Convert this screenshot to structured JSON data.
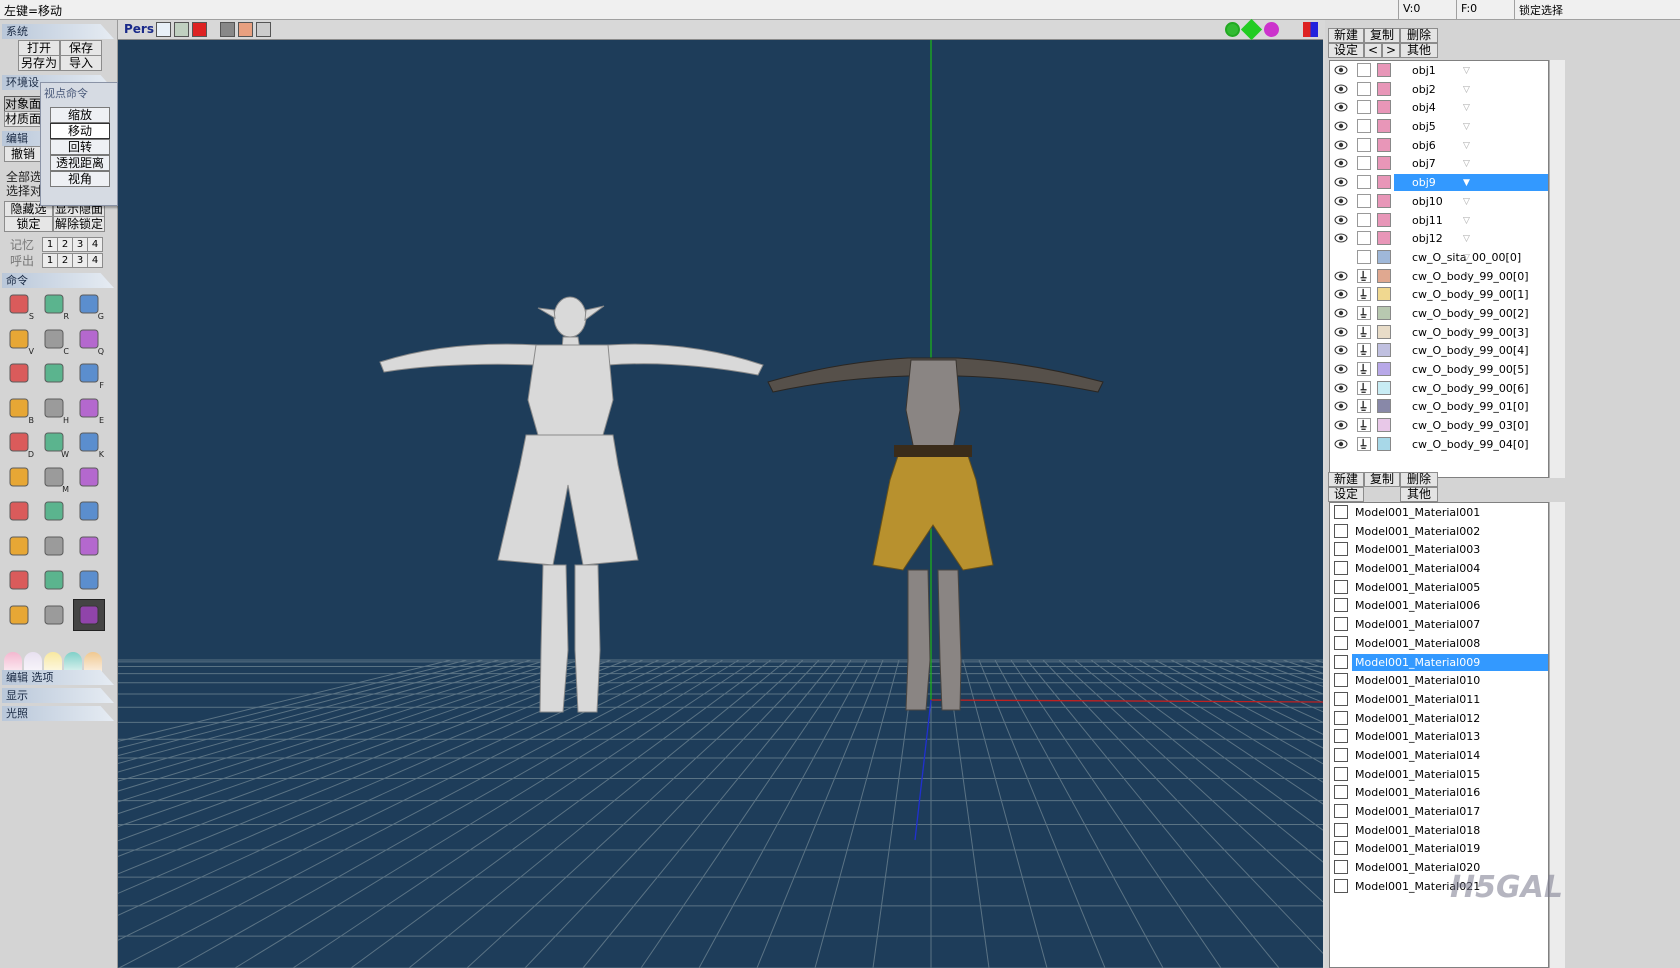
{
  "status": {
    "message": "左键=移动",
    "v": "V:0",
    "f": "F:0",
    "mode": "锁定选择"
  },
  "left": {
    "sections": {
      "system": "系统",
      "env": "环境设",
      "edit": "编辑",
      "command": "命令",
      "edit_options": "编辑 选项",
      "display": "显示",
      "light": "光照"
    },
    "file": {
      "open": "打开",
      "save": "保存",
      "save_as": "另存为",
      "import": "导入"
    },
    "side_buttons": {
      "object": "对象面",
      "material": "材质面",
      "undo": "撤销",
      "select_all": "全部选",
      "select_obj": "选择对"
    },
    "hide_show": {
      "hide": "隐藏选面",
      "show": "显示隐面",
      "lock": "锁定",
      "unlock": "解除锁定"
    },
    "memory": {
      "label": "记忆",
      "recall": "呼出",
      "slots": [
        "1",
        "2",
        "3",
        "4"
      ]
    },
    "popup": {
      "title": "视点命令",
      "items": [
        "缩放",
        "移动",
        "回转",
        "透视距离",
        "视角"
      ],
      "active": "移动"
    },
    "tool_icons": [
      "select-arrow-icon",
      "rect-select-icon",
      "lasso-select-icon",
      "move-icon",
      "rotate-icon",
      "scale-icon",
      "vertex-edit-icon",
      "box-icon",
      "plane-icon",
      "magnet-icon",
      "grid-split-icon",
      "extrude-icon",
      "bucket-icon",
      "knife-icon",
      "slice-icon",
      "axis-rotate-icon",
      "wand-icon",
      "angle-icon",
      "lattice-icon",
      "bend-icon",
      "bevel-icon",
      "cylinder-icon",
      "uv-cylinder-icon",
      "paint-palette-icon",
      "box-move-icon",
      "mirror-icon",
      "vertex-box-icon",
      "join-icon",
      "document-icon",
      "render-icon"
    ],
    "shortcut_keys": [
      "S",
      "R",
      "G",
      "V",
      "C",
      "Q",
      "",
      "",
      "F",
      "B",
      "H",
      "E",
      "D",
      "W",
      "K",
      "",
      "M",
      "",
      "",
      "",
      "",
      "",
      "",
      "",
      "",
      "",
      "",
      "",
      "",
      ""
    ]
  },
  "viewport": {
    "mode_label": "Pers"
  },
  "objects": {
    "buttons": {
      "new": "新建",
      "copy": "复制",
      "delete": "删除",
      "settings": "设定",
      "prev": "<",
      "next": ">",
      "other": "其他"
    },
    "items": [
      {
        "name": "obj1",
        "color": "#e896b8",
        "visible": true,
        "locked": false
      },
      {
        "name": "obj2",
        "color": "#e896b8",
        "visible": true,
        "locked": false
      },
      {
        "name": "obj4",
        "color": "#e896b8",
        "visible": true,
        "locked": false
      },
      {
        "name": "obj5",
        "color": "#e896b8",
        "visible": true,
        "locked": false
      },
      {
        "name": "obj6",
        "color": "#e896b8",
        "visible": true,
        "locked": false
      },
      {
        "name": "obj7",
        "color": "#e896b8",
        "visible": true,
        "locked": false
      },
      {
        "name": "obj9",
        "color": "#e896b8",
        "visible": true,
        "locked": false,
        "selected": true
      },
      {
        "name": "obj10",
        "color": "#e896b8",
        "visible": true,
        "locked": false
      },
      {
        "name": "obj11",
        "color": "#e896b8",
        "visible": true,
        "locked": false
      },
      {
        "name": "obj12",
        "color": "#e896b8",
        "visible": true,
        "locked": false
      },
      {
        "name": "cw_O_sita_00_00[0]",
        "color": "#9fb8d9",
        "visible": false,
        "locked": false
      },
      {
        "name": "cw_O_body_99_00[0]",
        "color": "#e0a890",
        "visible": true,
        "locked": true
      },
      {
        "name": "cw_O_body_99_00[1]",
        "color": "#f0d890",
        "visible": true,
        "locked": true
      },
      {
        "name": "cw_O_body_99_00[2]",
        "color": "#b8c8b0",
        "visible": true,
        "locked": true
      },
      {
        "name": "cw_O_body_99_00[3]",
        "color": "#e8dcc8",
        "visible": true,
        "locked": true
      },
      {
        "name": "cw_O_body_99_00[4]",
        "color": "#c0c0e0",
        "visible": true,
        "locked": true
      },
      {
        "name": "cw_O_body_99_00[5]",
        "color": "#b8a8e8",
        "visible": true,
        "locked": true
      },
      {
        "name": "cw_O_body_99_00[6]",
        "color": "#c8ecf4",
        "visible": true,
        "locked": true
      },
      {
        "name": "cw_O_body_99_01[0]",
        "color": "#8888a8",
        "visible": true,
        "locked": true
      },
      {
        "name": "cw_O_body_99_03[0]",
        "color": "#e8c8e8",
        "visible": true,
        "locked": true
      },
      {
        "name": "cw_O_body_99_04[0]",
        "color": "#a8d8e8",
        "visible": true,
        "locked": true
      }
    ]
  },
  "materials": {
    "buttons": {
      "new": "新建",
      "copy": "复制",
      "delete": "删除",
      "settings": "设定",
      "other": "其他"
    },
    "items": [
      "Model001_Material001",
      "Model001_Material002",
      "Model001_Material003",
      "Model001_Material004",
      "Model001_Material005",
      "Model001_Material006",
      "Model001_Material007",
      "Model001_Material008",
      "Model001_Material009",
      "Model001_Material010",
      "Model001_Material011",
      "Model001_Material012",
      "Model001_Material013",
      "Model001_Material014",
      "Model001_Material015",
      "Model001_Material016",
      "Model001_Material017",
      "Model001_Material018",
      "Model001_Material019",
      "Model001_Material020",
      "Model001_Material021"
    ],
    "selected": "Model001_Material009"
  },
  "watermark": "H5GAL",
  "colors": {
    "viewport_bg": "#1e3d5a",
    "selection": "#3399ff",
    "grid": "#6f8593"
  }
}
